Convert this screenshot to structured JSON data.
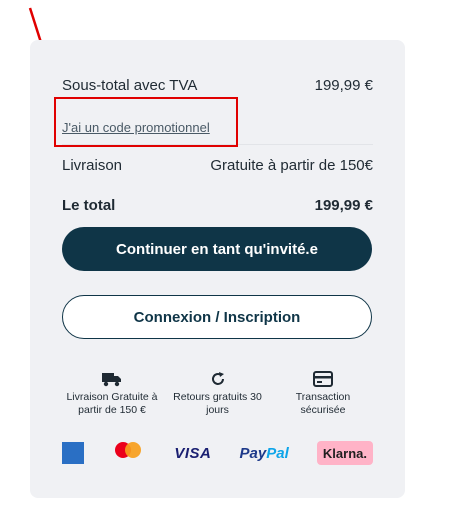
{
  "summary": {
    "subtotal_label": "Sous-total avec TVA",
    "subtotal_value": "199,99 €",
    "promo_link": "J'ai un code promotionnel",
    "shipping_label": "Livraison",
    "shipping_value": "Gratuite à partir de 150€",
    "total_label": "Le total",
    "total_value": "199,99 €"
  },
  "buttons": {
    "guest": "Continuer en tant qu'invité.e",
    "login": "Connexion / Inscription"
  },
  "features": [
    {
      "icon": "truck-icon",
      "label": "Livraison Gratuite à partir de 150 €"
    },
    {
      "icon": "refresh-icon",
      "label": "Retours gratuits 30 jours"
    },
    {
      "icon": "card-icon",
      "label": "Transaction sécurisée"
    }
  ],
  "payments": {
    "amex": "AMERICAN EXPRESS",
    "mastercard": "mastercard",
    "visa": "VISA",
    "paypal_a": "Pay",
    "paypal_b": "Pal",
    "klarna": "Klarna."
  },
  "colors": {
    "primary": "#0f3547",
    "card_bg": "#f0f1f4",
    "annotation": "#e00000",
    "klarna_pink": "#ffb3c7"
  }
}
